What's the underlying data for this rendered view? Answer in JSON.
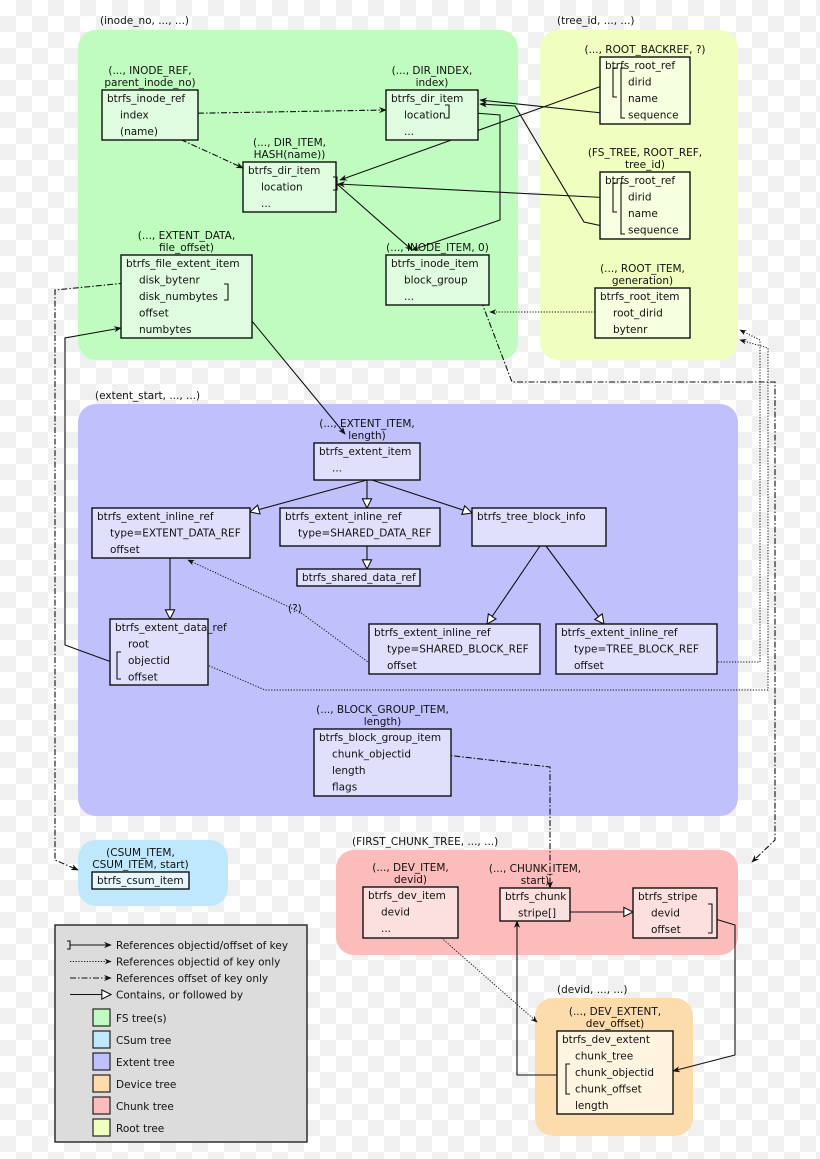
{
  "regions": {
    "fs": {
      "label": "(inode_no, ..., ...)",
      "color": "#c0fcc0"
    },
    "root": {
      "label": "(tree_id, ..., ...)",
      "color": "#eeffbf"
    },
    "extent": {
      "label": "(extent_start, ..., ...)",
      "color": "#c0c0fc"
    },
    "csum": {
      "label": "",
      "color": "#bfe8fc"
    },
    "chunk": {
      "label": "(FIRST_CHUNK_TREE, ..., ...)",
      "color": "#fcbcbc"
    },
    "device": {
      "label": "(devid, ..., ...)",
      "color": "#fcdcac"
    }
  },
  "boxes": {
    "inode_ref": {
      "key": [
        "(..., INODE_REF,",
        "parent_inode_no)"
      ],
      "title": "btrfs_inode_ref",
      "fields": [
        "index",
        "(name)"
      ],
      "fill": "#e0fce0"
    },
    "dir_index": {
      "key": [
        "(..., DIR_INDEX,",
        "index)"
      ],
      "title": "btrfs_dir_item",
      "fields": [
        "location",
        "..."
      ],
      "fill": "#e0fce0"
    },
    "dir_item": {
      "key": [
        "(..., DIR_ITEM,",
        "HASH(name))"
      ],
      "title": "btrfs_dir_item",
      "fields": [
        "location",
        "..."
      ],
      "fill": "#e0fce0"
    },
    "file_extent": {
      "key": [
        "(..., EXTENT_DATA,",
        "file_offset)"
      ],
      "title": "btrfs_file_extent_item",
      "fields": [
        "disk_bytenr",
        "disk_numbytes",
        "offset",
        "numbytes"
      ],
      "fill": "#e0fce0"
    },
    "inode_item": {
      "key": [
        "(..., INODE_ITEM, 0)"
      ],
      "title": "btrfs_inode_item",
      "fields": [
        "block_group",
        "..."
      ],
      "fill": "#e0fce0"
    },
    "root_backref": {
      "key": [
        "(..., ROOT_BACKREF, ?)"
      ],
      "title": "btrfs_root_ref",
      "fields": [
        "dirid",
        "name",
        "sequence"
      ],
      "fill": "#f6ffe0"
    },
    "root_ref": {
      "key": [
        "(FS_TREE, ROOT_REF,",
        "tree_id)"
      ],
      "title": "btrfs_root_ref",
      "fields": [
        "dirid",
        "name",
        "sequence"
      ],
      "fill": "#f6ffe0"
    },
    "root_item": {
      "key": [
        "(..., ROOT_ITEM,",
        "generation)"
      ],
      "title": "btrfs_root_item",
      "fields": [
        "root_dirid",
        "bytenr"
      ],
      "fill": "#f6ffe0"
    },
    "extent_item": {
      "key": [
        "(..., EXTENT_ITEM,",
        "length)"
      ],
      "title": "btrfs_extent_item",
      "fields": [
        "..."
      ],
      "fill": "#e0e0fc"
    },
    "inline_edr": {
      "key": [],
      "title": "btrfs_extent_inline_ref",
      "fields": [
        "type=EXTENT_DATA_REF",
        "offset"
      ],
      "fill": "#e0e0fc"
    },
    "inline_sdr": {
      "key": [],
      "title": "btrfs_extent_inline_ref",
      "fields": [
        "type=SHARED_DATA_REF"
      ],
      "fill": "#e0e0fc"
    },
    "tree_block_info": {
      "key": [],
      "title": "btrfs_tree_block_info",
      "fields": [],
      "fill": "#e0e0fc"
    },
    "shared_data_ref": {
      "key": [],
      "title": "btrfs_shared_data_ref",
      "fields": [],
      "fill": "#e0e0fc"
    },
    "extent_data_ref": {
      "key": [],
      "title": "btrfs_extent_data_ref",
      "fields": [
        "root",
        "objectid",
        "offset"
      ],
      "fill": "#e0e0fc"
    },
    "inline_sbr": {
      "key": [],
      "title": "btrfs_extent_inline_ref",
      "fields": [
        "type=SHARED_BLOCK_REF",
        "offset"
      ],
      "fill": "#e0e0fc"
    },
    "inline_tbr": {
      "key": [],
      "title": "btrfs_extent_inline_ref",
      "fields": [
        "type=TREE_BLOCK_REF",
        "offset"
      ],
      "fill": "#e0e0fc"
    },
    "block_group": {
      "key": [
        "(..., BLOCK_GROUP_ITEM,",
        "length)"
      ],
      "title": "btrfs_block_group_item",
      "fields": [
        "chunk_objectid",
        "length",
        "flags"
      ],
      "fill": "#e0e0fc"
    },
    "csum_item": {
      "key": [
        "(CSUM_ITEM,",
        "CSUM_ITEM, start)"
      ],
      "title": "btrfs_csum_item",
      "fields": [],
      "fill": "#e6f6fc"
    },
    "dev_item": {
      "key": [
        "(..., DEV_ITEM,",
        "devid)"
      ],
      "title": "btrfs_dev_item",
      "fields": [
        "devid",
        "..."
      ],
      "fill": "#fce0e0"
    },
    "chunk": {
      "key": [
        "(..., CHUNK_ITEM,",
        "start)"
      ],
      "title": "btrfs_chunk",
      "fields": [
        "stripe[]"
      ],
      "fill": "#fce0e0"
    },
    "stripe": {
      "key": [],
      "title": "btrfs_stripe",
      "fields": [
        "devid",
        "offset"
      ],
      "fill": "#fce0e0"
    },
    "dev_extent": {
      "key": [
        "(..., DEV_EXTENT,",
        "dev_offset)"
      ],
      "title": "btrfs_dev_extent",
      "fields": [
        "chunk_tree",
        "chunk_objectid",
        "chunk_offset",
        "length"
      ],
      "fill": "#fff4e0"
    }
  },
  "annotations": {
    "uncertain": "(?)"
  },
  "legend": {
    "background": "#dcdcdc",
    "lines": [
      {
        "style": "bracket-solid",
        "label": "References objectid/offset of key"
      },
      {
        "style": "dotted",
        "label": "References objectid of key only"
      },
      {
        "style": "dashdot",
        "label": "References offset of key only"
      },
      {
        "style": "contains",
        "label": "Contains, or followed by"
      }
    ],
    "trees": [
      {
        "label": "FS tree(s)",
        "color": "#c0fcc0"
      },
      {
        "label": "CSum tree",
        "color": "#bfe8fc"
      },
      {
        "label": "Extent tree",
        "color": "#c0c0fc"
      },
      {
        "label": "Device tree",
        "color": "#fcdcac"
      },
      {
        "label": "Chunk tree",
        "color": "#fcbcbc"
      },
      {
        "label": "Root tree",
        "color": "#eeffbf"
      }
    ]
  }
}
